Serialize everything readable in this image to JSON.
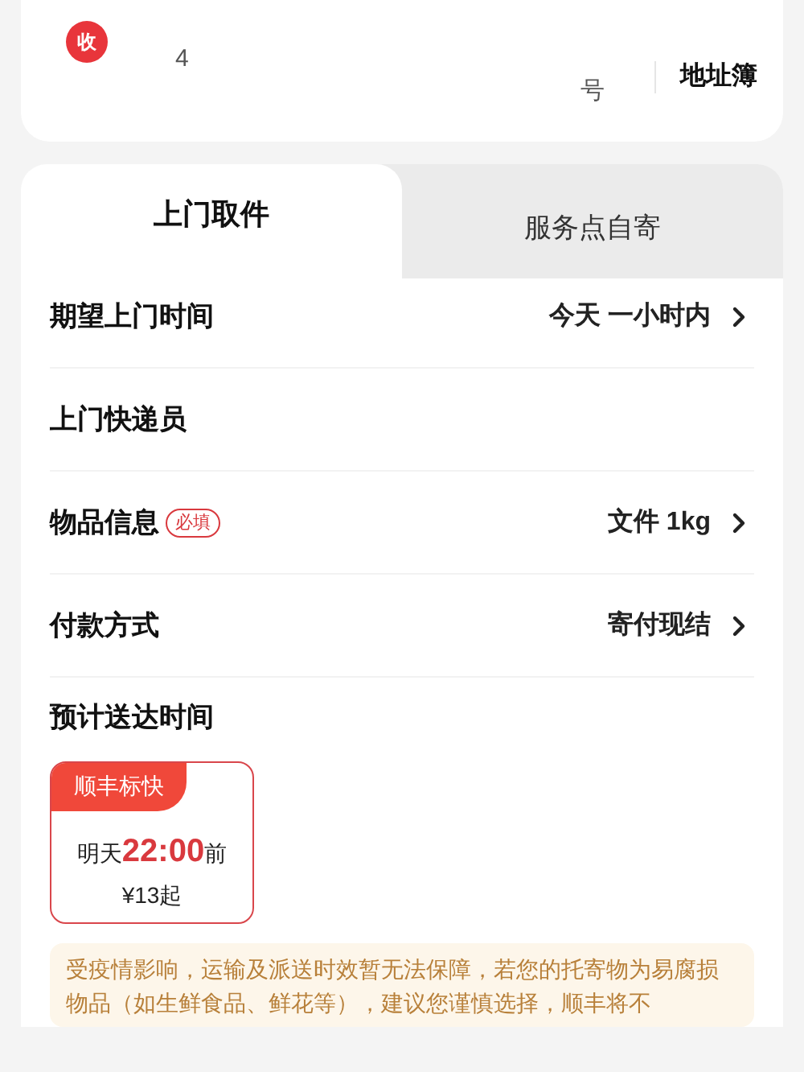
{
  "receiver": {
    "badge": "收",
    "address_fragment": "4",
    "address_end": "号",
    "address_book": "地址簿"
  },
  "tabs": [
    {
      "label": "上门取件",
      "selected": true
    },
    {
      "label": "服务点自寄",
      "selected": false
    }
  ],
  "rows": [
    {
      "label": "期望上门时间",
      "value": "今天 一小时内"
    },
    {
      "label": "上门快递员"
    },
    {
      "label": "物品信息",
      "tag": "必填",
      "value": "文件 1kg"
    },
    {
      "label": "付款方式",
      "value": "寄付现结"
    }
  ],
  "delivery": {
    "title": "预计送达时间",
    "option": {
      "name": "顺丰标快",
      "day": "明天",
      "time": "22:00",
      "suffix": "前",
      "price": "¥13起",
      "selected": true
    }
  },
  "notice": "受疫情影响，运输及派送时效暂无法保障，若您的托寄物为易腐损物品（如生鲜食品、鲜花等），建议您谨慎选择，顺丰将不"
}
